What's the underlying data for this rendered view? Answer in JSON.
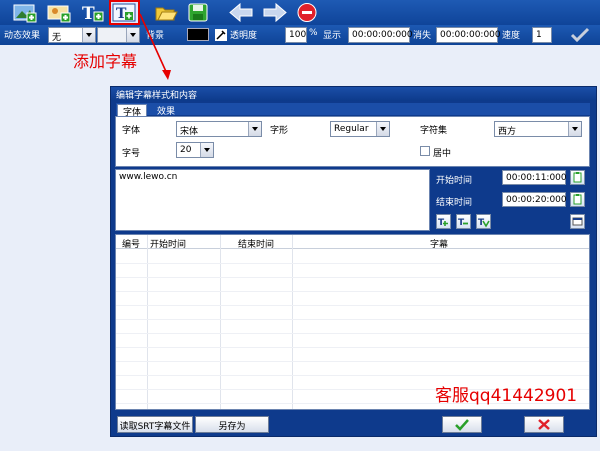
{
  "toolbar": {
    "icons": [
      "image-add-icon",
      "photo-add-icon",
      "text-add-icon",
      "subtitle-add-icon",
      "folder-open-icon",
      "save-icon",
      "arrow-left-icon",
      "arrow-right-icon",
      "stop-icon"
    ]
  },
  "propbar": {
    "effect_label": "动态效果",
    "effect_value": "无",
    "background_label": "背景",
    "opacity_label": "透明度",
    "opacity_value": "100",
    "percent": "%",
    "show_label": "显示",
    "show_value": "00:00:00:000",
    "hide_label": "消失",
    "hide_value": "00:00:00:000",
    "speed_label": "速度",
    "speed_value": "1"
  },
  "annotation": "添加字幕",
  "dialog": {
    "title": "编辑字幕样式和内容",
    "tabs": [
      "字体",
      "效果"
    ],
    "font_label": "字体",
    "font_value": "宋体",
    "style_label": "字形",
    "style_value": "Regular",
    "charset_label": "字符集",
    "charset_value": "西方",
    "size_label": "字号",
    "size_value": "20",
    "center_label": "居中",
    "subtitle_text": "www.lewo.cn",
    "start_label": "开始时间",
    "start_value": "00:00:11:000",
    "end_label": "结束时间",
    "end_value": "00:00:20:000",
    "columns": [
      "编号",
      "开始时间",
      "结束时间",
      "字幕"
    ],
    "watermark": "客服qq41442901",
    "read_srt_label": "读取SRT字幕文件",
    "save_as_label": "另存为"
  },
  "colors": {
    "toolbar": "#1e5ab4",
    "dialog": "#0e3a8c",
    "accent_red": "#e60000",
    "ok_green": "#2aa02a"
  }
}
